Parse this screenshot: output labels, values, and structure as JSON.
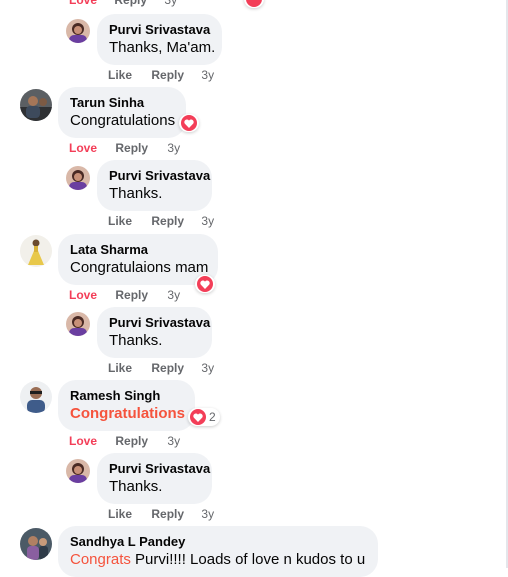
{
  "colors": {
    "love": "#f33e58",
    "highlight": "#f5533d",
    "muted": "#65676b",
    "bubble": "#f0f2f5"
  },
  "actions": {
    "love": "Love",
    "like": "Like",
    "reply": "Reply",
    "time": "3y"
  },
  "comments": [
    {
      "name": "Purvi Srivastava",
      "text": "Thanks, Ma'am."
    },
    {
      "name": "Tarun Sinha",
      "text": "Congratulations"
    },
    {
      "name": "Purvi Srivastava",
      "text": "Thanks."
    },
    {
      "name": "Lata Sharma",
      "text": "Congratulaions mam"
    },
    {
      "name": "Purvi Srivastava",
      "text": "Thanks."
    },
    {
      "name": "Ramesh Singh",
      "text": "Congratulations",
      "reaction_count": "2"
    },
    {
      "name": "Purvi Srivastava",
      "text": "Thanks."
    },
    {
      "name": "Sandhya L Pandey",
      "text_highlight": "Congrats",
      "text_rest": " Purvi!!!! Loads of love n kudos to u"
    }
  ]
}
